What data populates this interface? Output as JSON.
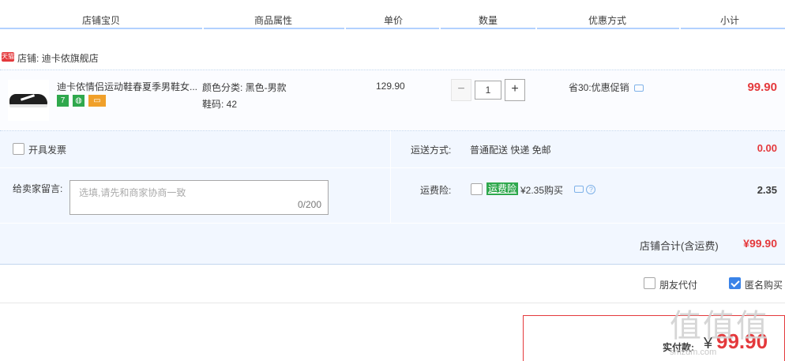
{
  "header": {
    "columns": [
      "店铺宝贝",
      "商品属性",
      "单价",
      "数量",
      "优惠方式",
      "小计"
    ]
  },
  "shop": {
    "badge": "天猫",
    "label": "店铺:",
    "name": "迪卡侬旗舰店"
  },
  "item": {
    "title": "迪卡侬情侣运动鞋春夏季男鞋女...",
    "icon_names": [
      "seven-day-return-icon",
      "warranty-icon",
      "card-icon"
    ],
    "attr_color": "颜色分类:  黑色-男款",
    "attr_size": "鞋码:  42",
    "unit_price": "129.90",
    "quantity": "1",
    "minus_label": "−",
    "plus_label": "+",
    "promo": "省30:优惠促销",
    "subtotal": "99.90"
  },
  "invoice": {
    "label": "开具发票",
    "checked": false
  },
  "shipping": {
    "label": "运送方式:",
    "method": "普通配送 快递 免邮",
    "fee": "0.00"
  },
  "memo": {
    "label": "给卖家留言:",
    "placeholder": "选填,请先和商家协商一致",
    "count": "0/200"
  },
  "insurance": {
    "label": "运费险:",
    "badge": "运费险",
    "price_text": "¥2.35购买",
    "help": "?",
    "fee": "2.35",
    "checked": false
  },
  "shop_total": {
    "label": "店铺合计(含运费)",
    "value": "¥99.90"
  },
  "options": {
    "friend_pay": "朋友代付",
    "anonymous": "匿名购买",
    "anonymous_checked": true
  },
  "order_total": {
    "label": "实付款:",
    "currency": "¥",
    "value": "99.90"
  },
  "watermark": {
    "logo": "值值值",
    "site": "smzdm.com"
  },
  "colors": {
    "accent_red": "#e4393c",
    "header_line": "#b2d1ff",
    "panel_bg": "#f2f7ff",
    "checkbox_blue": "#3a83e8",
    "insurance_green": "#2fa84d"
  }
}
